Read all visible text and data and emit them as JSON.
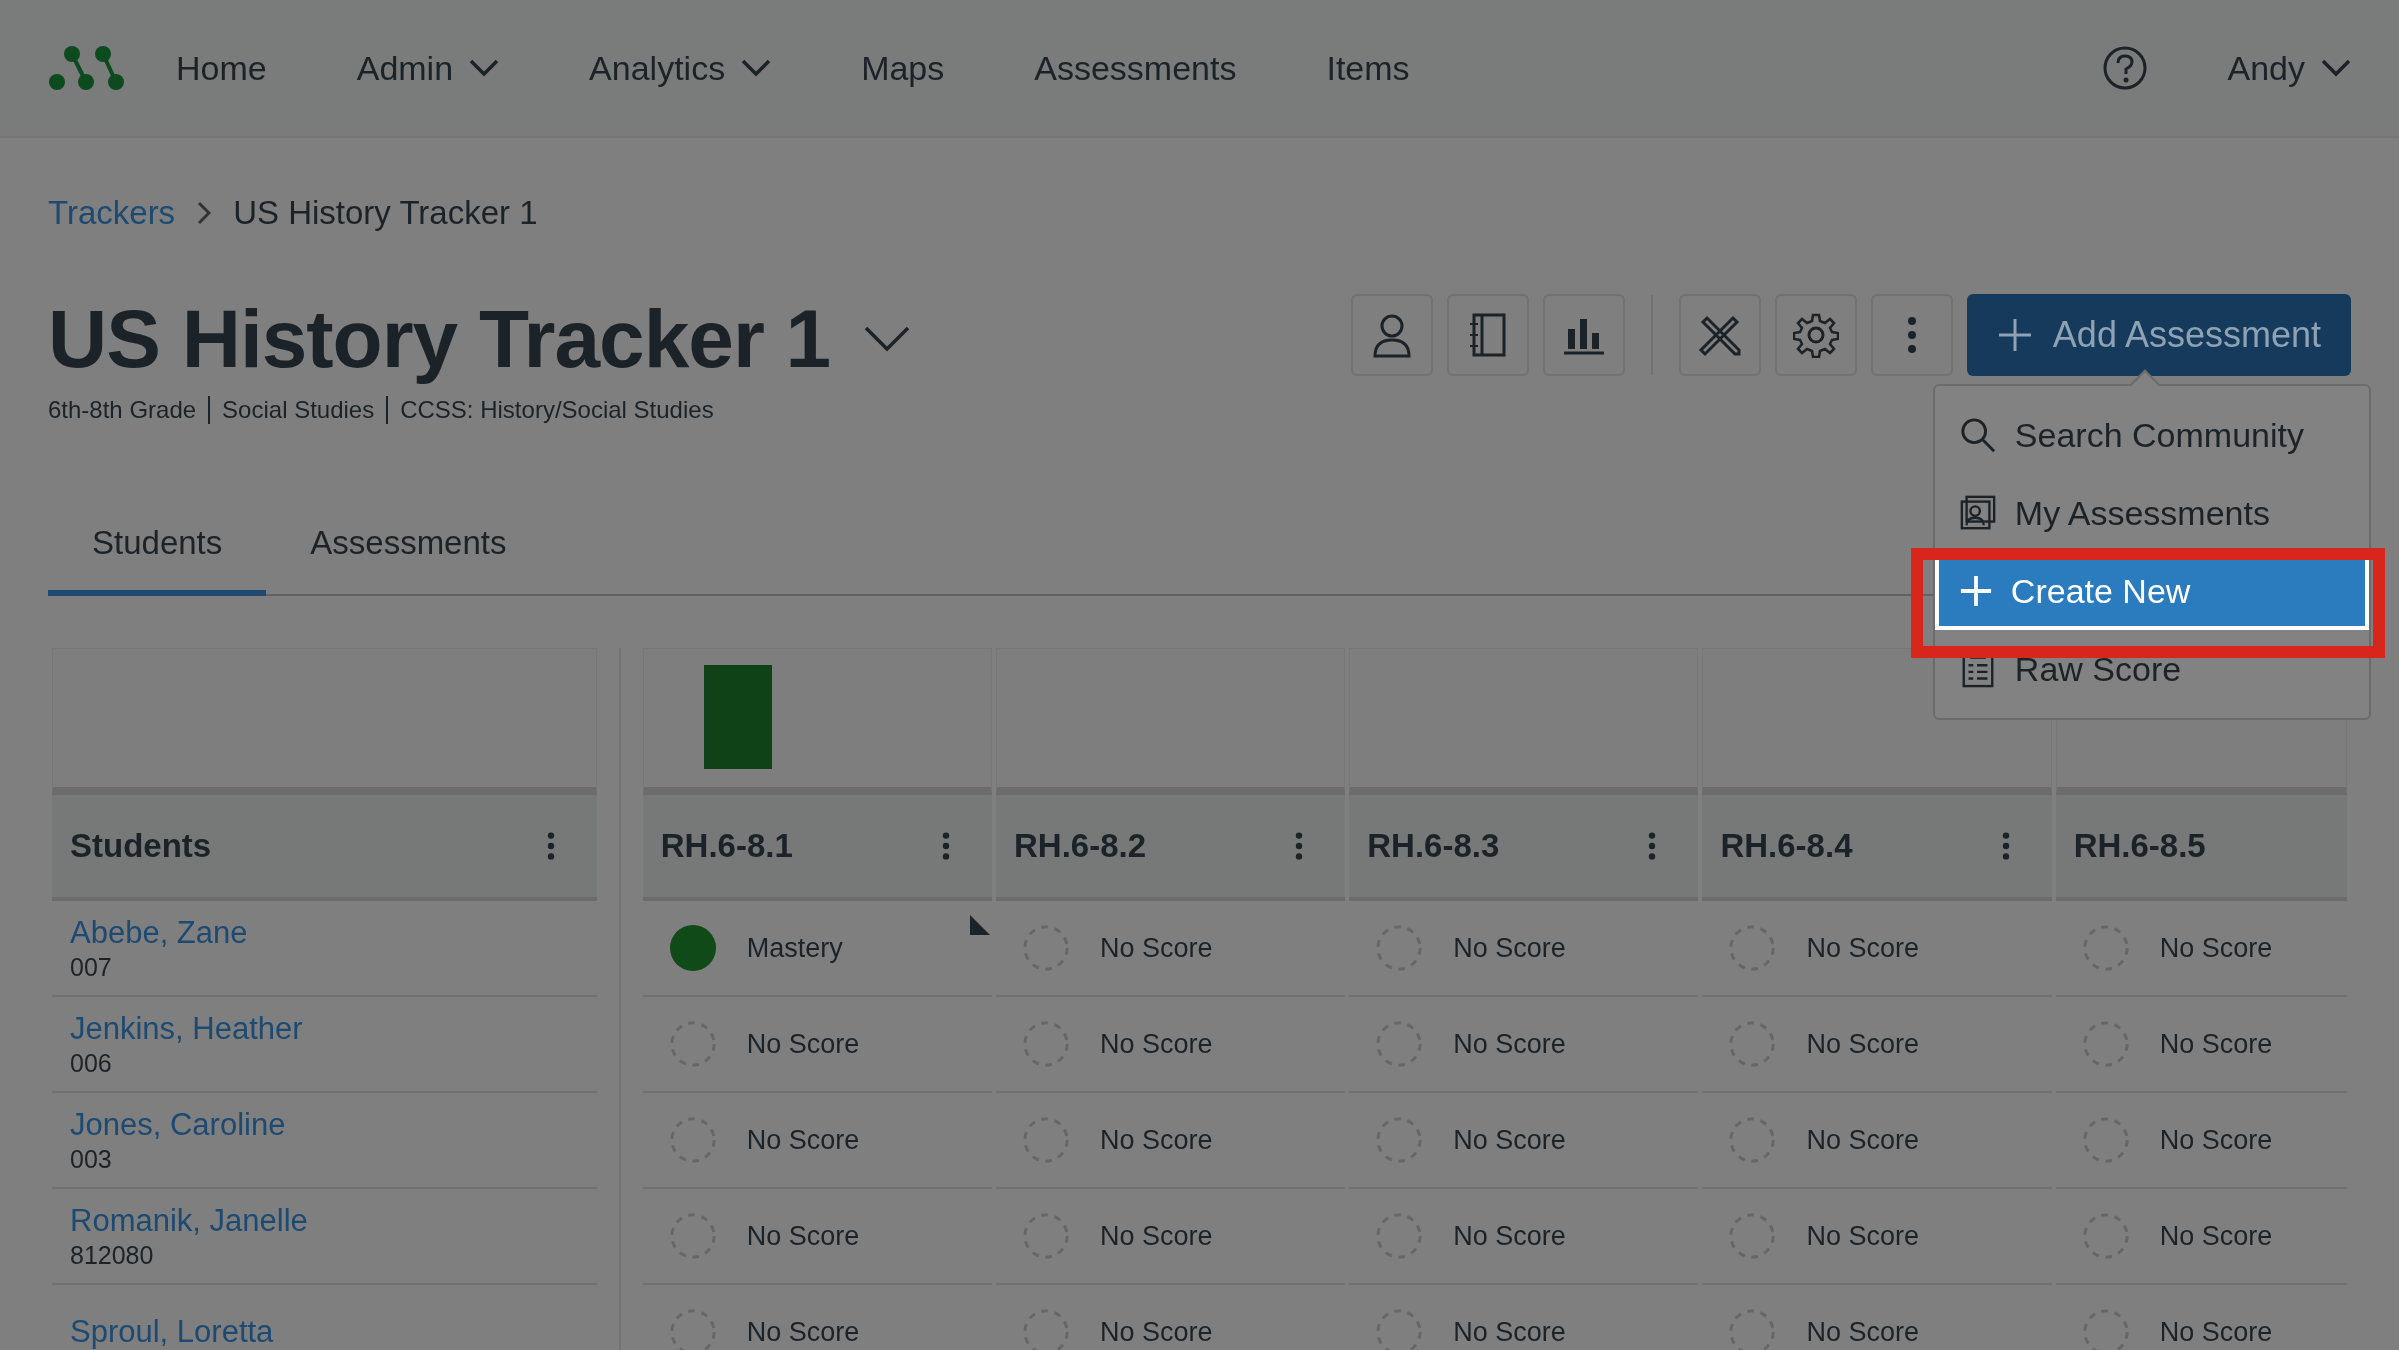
{
  "nav": {
    "items": [
      {
        "label": "Home",
        "has_menu": false
      },
      {
        "label": "Admin",
        "has_menu": true
      },
      {
        "label": "Analytics",
        "has_menu": true
      },
      {
        "label": "Maps",
        "has_menu": false
      },
      {
        "label": "Assessments",
        "has_menu": false
      },
      {
        "label": "Items",
        "has_menu": false
      }
    ],
    "user": "Andy"
  },
  "breadcrumb": {
    "link": "Trackers",
    "current": "US History Tracker 1"
  },
  "title": "US History Tracker 1",
  "subtitle": [
    "6th-8th Grade",
    "Social Studies",
    "CCSS: History/Social Studies"
  ],
  "add_button": "Add Assessment",
  "menu": [
    {
      "label": "Search Community",
      "kind": "search",
      "selected": false
    },
    {
      "label": "My Assessments",
      "kind": "mine",
      "selected": false
    },
    {
      "label": "Create New",
      "kind": "create",
      "selected": true
    },
    {
      "label": "Raw Score",
      "kind": "raw",
      "selected": false
    }
  ],
  "tabs": [
    {
      "label": "Students",
      "selected": true
    },
    {
      "label": "Assessments",
      "selected": false
    }
  ],
  "students_header": "Students",
  "columns": [
    {
      "label": "RH.6-8.1",
      "bar": true,
      "menu": true
    },
    {
      "label": "RH.6-8.2",
      "bar": false,
      "menu": true
    },
    {
      "label": "RH.6-8.3",
      "bar": false,
      "menu": true
    },
    {
      "label": "RH.6-8.4",
      "bar": false,
      "menu": true
    },
    {
      "label": "RH.6-8.5",
      "bar": false,
      "menu": false
    }
  ],
  "rows": [
    {
      "name": "Abebe, Zane",
      "id": "007",
      "scores": [
        {
          "kind": "mastery",
          "label": "Mastery"
        },
        {
          "kind": "none",
          "label": "No Score"
        },
        {
          "kind": "none",
          "label": "No Score"
        },
        {
          "kind": "none",
          "label": "No Score"
        },
        {
          "kind": "none",
          "label": "No Score"
        }
      ]
    },
    {
      "name": "Jenkins, Heather",
      "id": "006",
      "scores": [
        {
          "kind": "none",
          "label": "No Score"
        },
        {
          "kind": "none",
          "label": "No Score"
        },
        {
          "kind": "none",
          "label": "No Score"
        },
        {
          "kind": "none",
          "label": "No Score"
        },
        {
          "kind": "none",
          "label": "No Score"
        }
      ]
    },
    {
      "name": "Jones, Caroline",
      "id": "003",
      "scores": [
        {
          "kind": "none",
          "label": "No Score"
        },
        {
          "kind": "none",
          "label": "No Score"
        },
        {
          "kind": "none",
          "label": "No Score"
        },
        {
          "kind": "none",
          "label": "No Score"
        },
        {
          "kind": "none",
          "label": "No Score"
        }
      ]
    },
    {
      "name": "Romanik, Janelle",
      "id": "812080",
      "scores": [
        {
          "kind": "none",
          "label": "No Score"
        },
        {
          "kind": "none",
          "label": "No Score"
        },
        {
          "kind": "none",
          "label": "No Score"
        },
        {
          "kind": "none",
          "label": "No Score"
        },
        {
          "kind": "none",
          "label": "No Score"
        }
      ]
    },
    {
      "name": "Sproul, Loretta",
      "scores": [
        {
          "kind": "none",
          "label": "No Score"
        },
        {
          "kind": "none",
          "label": "No Score"
        },
        {
          "kind": "none",
          "label": "No Score"
        },
        {
          "kind": "none",
          "label": "No Score"
        },
        {
          "kind": "none",
          "label": "No Score"
        }
      ]
    }
  ]
}
